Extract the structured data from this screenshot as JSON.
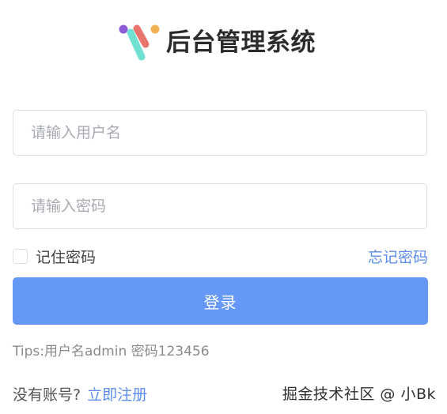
{
  "brand": {
    "title": "后台管理系统",
    "logo_icon": "colorful-v-logo-icon",
    "colors": {
      "purple": "#8e5bd6",
      "red": "#e8746c",
      "orange": "#f2b257",
      "teal": "#6fe0d2"
    }
  },
  "form": {
    "username_placeholder": "请输入用户名",
    "username_value": "",
    "password_placeholder": "请输入密码",
    "password_value": "",
    "remember_label": "记住密码",
    "remember_checked": false,
    "forgot_label": "忘记密码",
    "login_label": "登录",
    "primary_color": "#6699f7",
    "link_color": "#5b8ef0"
  },
  "tips": "Tips:用户名admin 密码123456",
  "register": {
    "prompt": "没有账号?",
    "link_label": "立即注册"
  },
  "watermark": "掘金技术社区 @ 小Bk"
}
